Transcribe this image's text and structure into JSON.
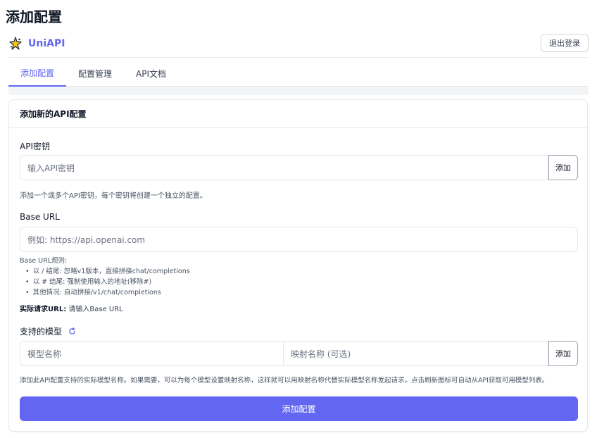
{
  "page": {
    "title": "添加配置"
  },
  "header": {
    "brand_name": "UniAPI",
    "logout_label": "退出登录"
  },
  "tabs": [
    {
      "label": "添加配置",
      "active": true
    },
    {
      "label": "配置管理",
      "active": false
    },
    {
      "label": "API文档",
      "active": false
    }
  ],
  "form": {
    "card_title": "添加新的API配置",
    "api_key": {
      "label": "API密钥",
      "placeholder": "输入API密钥",
      "add_label": "添加",
      "help": "添加一个或多个API密钥，每个密钥将创建一个独立的配置。"
    },
    "base_url": {
      "label": "Base URL",
      "placeholder": "例如: https://api.openai.com",
      "rules_title": "Base URL规则:",
      "rules": [
        "以 / 结尾: 忽略v1版本，直接拼接chat/completions",
        "以 # 结尾: 强制使用输入的地址(移除#)",
        "其他情况: 自动拼接/v1/chat/completions"
      ],
      "actual_label": "实际请求URL:",
      "actual_value": "请输入Base URL"
    },
    "models": {
      "label": "支持的模型",
      "model_placeholder": "模型名称",
      "mapping_placeholder": "映射名称 (可选)",
      "add_label": "添加",
      "help": "添加此API配置支持的实际模型名称。如果需要，可以为每个模型设置映射名称，这样就可以用映射名称代替实际模型名称发起请求。点击刷新图标可自动从API获取可用模型列表。"
    },
    "submit_label": "添加配置"
  },
  "colors": {
    "accent": "#6366f1",
    "border": "#e5e7eb",
    "band": "#f3f4f6"
  },
  "icons": {
    "brand": "sparkle-star-icon",
    "refresh": "refresh-icon"
  }
}
